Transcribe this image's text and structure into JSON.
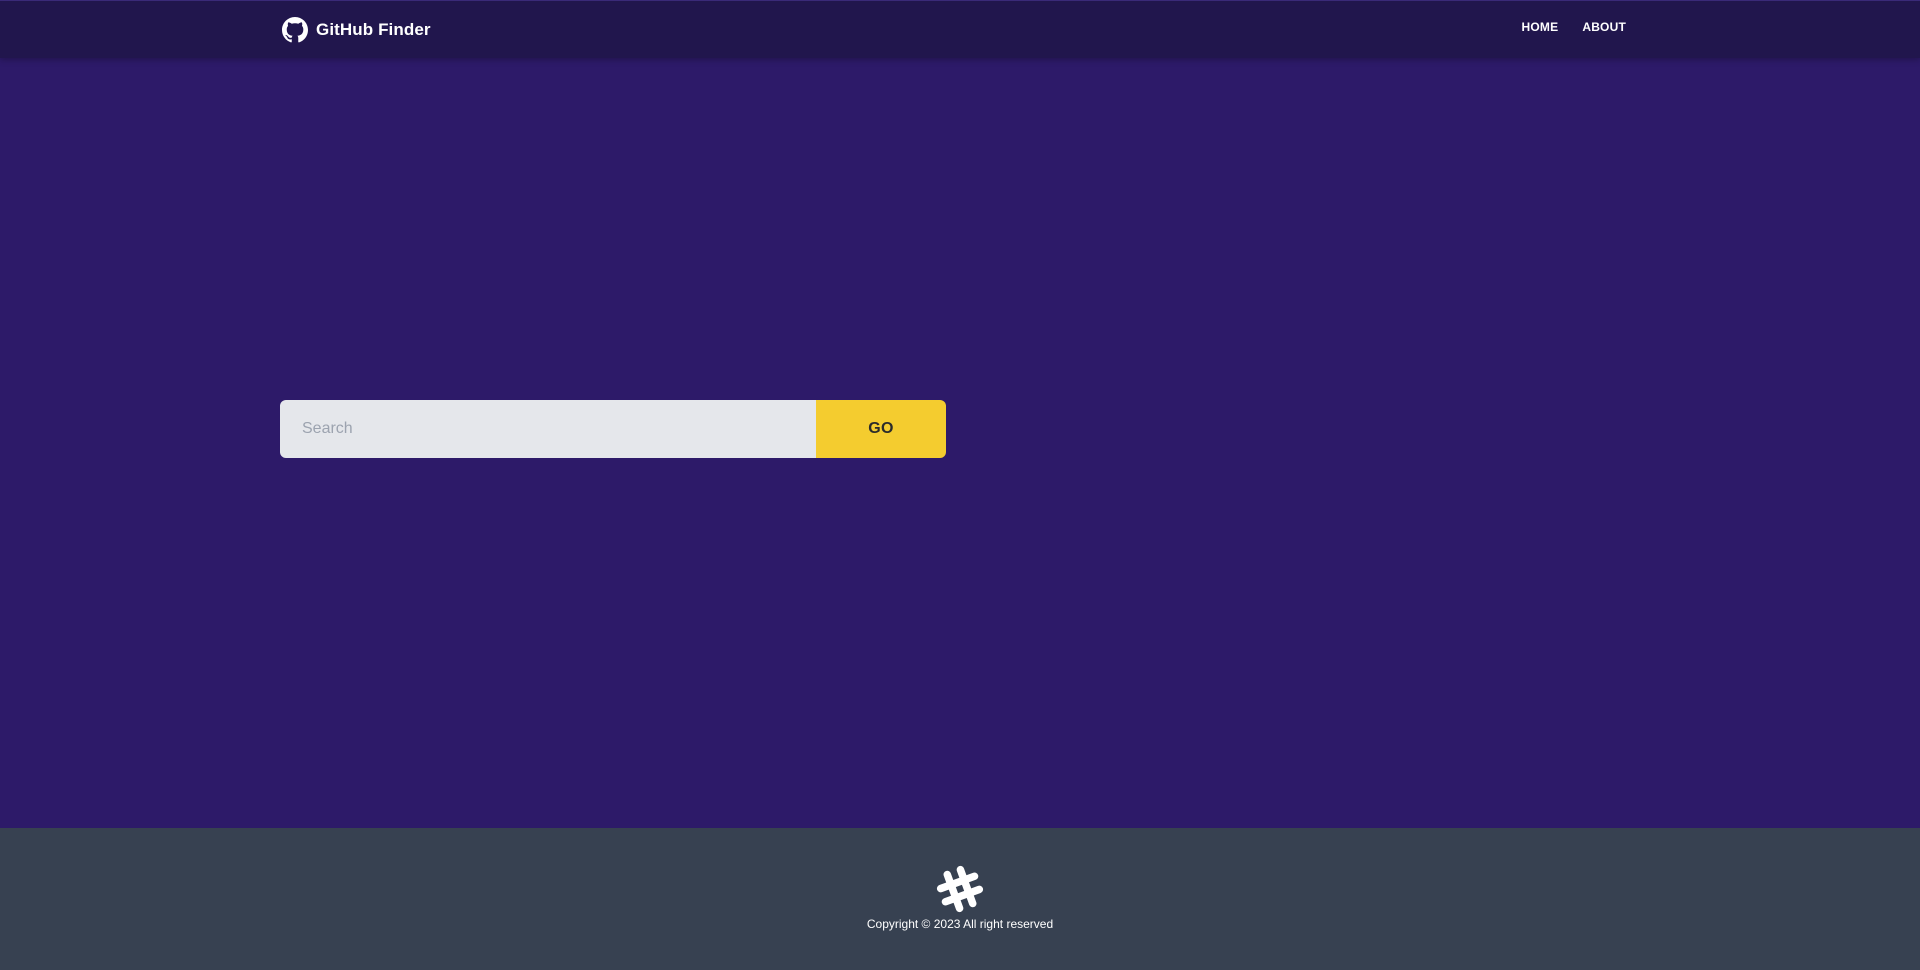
{
  "navbar": {
    "brand": "GitHub Finder",
    "brand_icon": "github-icon",
    "links": [
      {
        "label": "HOME"
      },
      {
        "label": "ABOUT"
      }
    ]
  },
  "search": {
    "placeholder": "Search",
    "value": "",
    "button_label": "GO"
  },
  "footer": {
    "logo_icon": "hash-logo-icon",
    "copyright": "Copyright © 2023 All right reserved"
  },
  "colors": {
    "background": "#2d1a69",
    "navbar": "#21164d",
    "input": "#e5e7eb",
    "button": "#f4cc2f",
    "footer": "#374151"
  }
}
